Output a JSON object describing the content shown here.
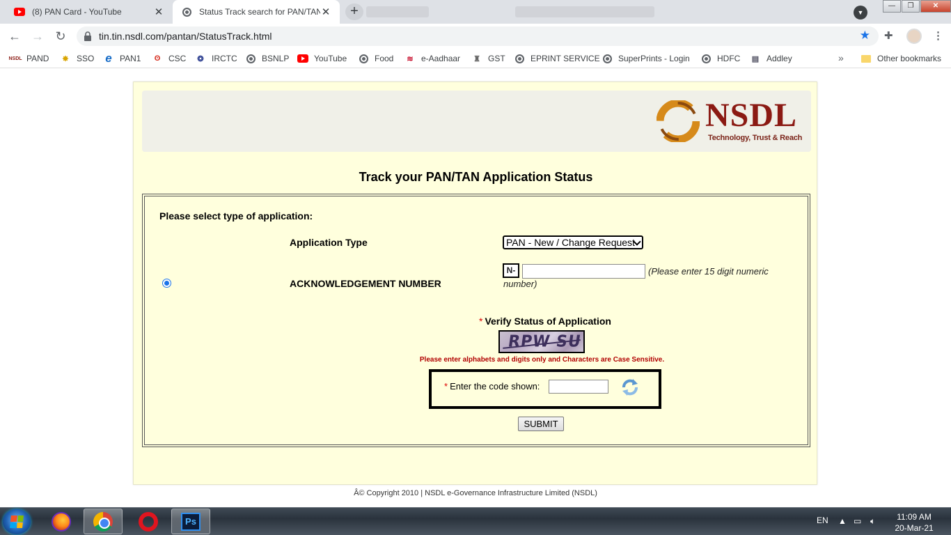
{
  "browser": {
    "tabs": [
      {
        "title": "(8) PAN Card - YouTube",
        "favicon": "youtube-icon",
        "active": false
      },
      {
        "title": "Status Track search for PAN/TAN",
        "favicon": "globe-icon",
        "active": true
      }
    ],
    "url": "tin.tin.nsdl.com/pantan/StatusTrack.html",
    "bookmarks": [
      {
        "label": "PAND",
        "icon": "nsdl-icon"
      },
      {
        "label": "SSO",
        "icon": "sso-icon"
      },
      {
        "label": "PAN1",
        "icon": "ie-icon"
      },
      {
        "label": "CSC",
        "icon": "csc-icon"
      },
      {
        "label": "IRCTC",
        "icon": "irctc-icon"
      },
      {
        "label": "BSNLP",
        "icon": "globe-icon"
      },
      {
        "label": "YouTube",
        "icon": "youtube-icon"
      },
      {
        "label": "Food",
        "icon": "globe-icon"
      },
      {
        "label": "e-Aadhaar",
        "icon": "aadhaar-icon"
      },
      {
        "label": "GST",
        "icon": "emblem-icon"
      },
      {
        "label": "EPRINT SERVICE",
        "icon": "globe-icon"
      },
      {
        "label": "SuperPrints - Login",
        "icon": "globe-icon"
      },
      {
        "label": "HDFC",
        "icon": "globe-icon"
      },
      {
        "label": "Addley",
        "icon": "addley-icon"
      }
    ],
    "more_bookmarks": "»",
    "other_bookmarks": "Other bookmarks"
  },
  "page": {
    "logo_text": "NSDL",
    "logo_tagline": "Technology, Trust & Reach",
    "title": "Track your PAN/TAN Application Status",
    "select_type_label": "Please select type of application:",
    "application_type_label": "Application Type",
    "application_type_value": "PAN - New / Change Request",
    "ack_label": "ACKNOWLEDGEMENT NUMBER",
    "ack_prefix": "N-",
    "ack_value": "",
    "ack_hint": "(Please enter 15 digit numeric number)",
    "verify_title": "Verify Status of Application",
    "required_mark": "*",
    "captcha_text": "RPW SU",
    "case_note": "Please enter alphabets and digits only and Characters are Case Sensitive.",
    "code_label": "Enter the code shown:",
    "code_value": "",
    "submit_label": "SUBMIT",
    "copyright": "Â© Copyright 2010  |  NSDL e-Governance Infrastructure Limited (NSDL)"
  },
  "taskbar": {
    "language": "EN",
    "time": "11:09 AM",
    "date": "20-Mar-21"
  },
  "colors": {
    "page_bg": "#ffffdd",
    "nsdl_red": "#8b1a13",
    "note_red": "#b10000",
    "accent_blue": "#1a73e8"
  }
}
